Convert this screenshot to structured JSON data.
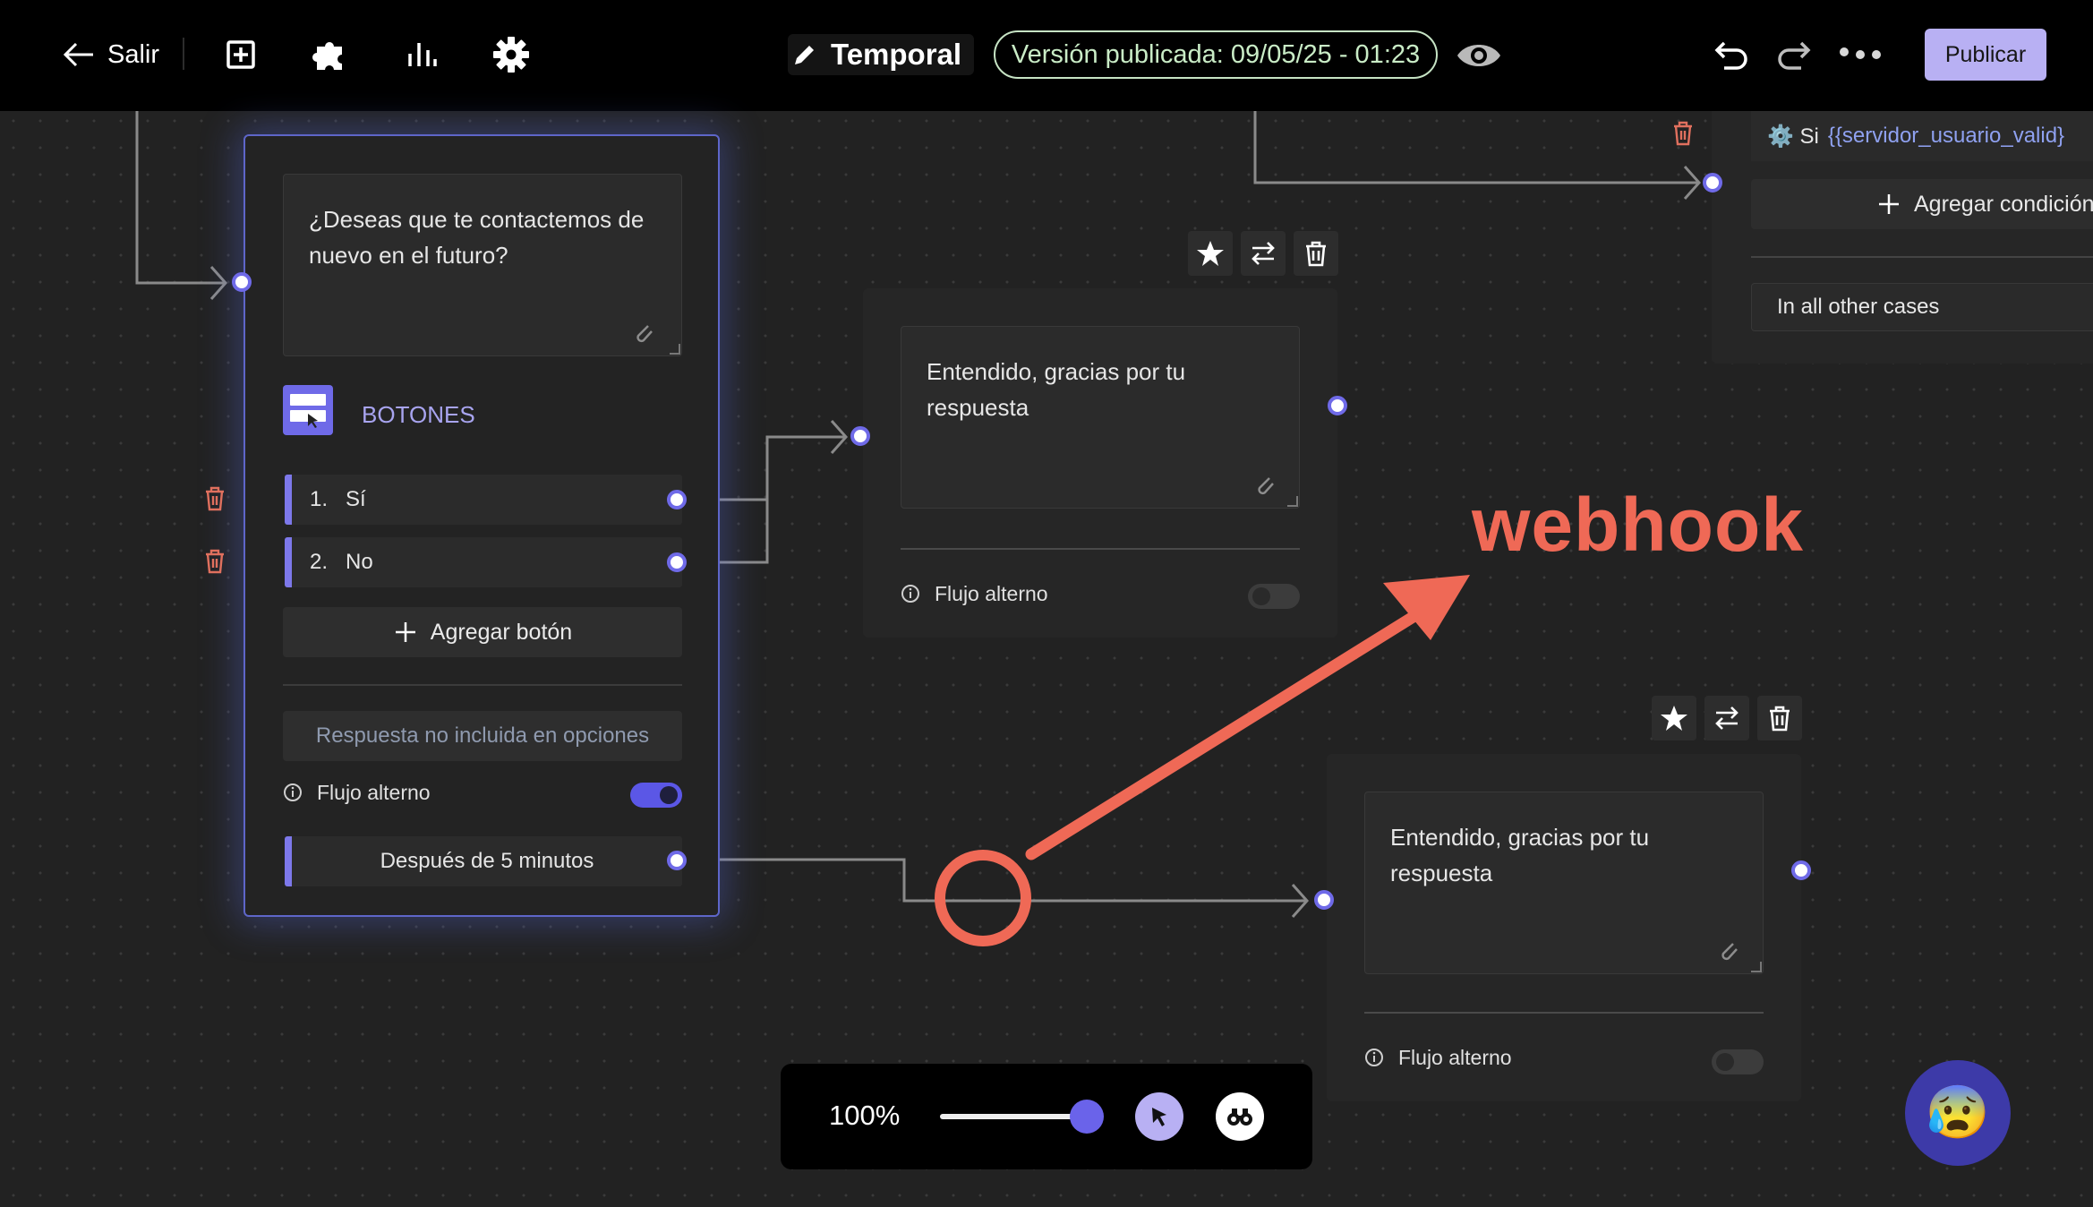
{
  "topbar": {
    "exit_label": "Salir",
    "flow_name": "Temporal",
    "version_badge": "Versión publicada: 09/05/25 - 01:23",
    "publish_label": "Publicar"
  },
  "question_node": {
    "message": "¿Deseas que te contactemos de nuevo en el futuro?",
    "section_title": "BOTONES",
    "buttons": [
      {
        "number": "1.",
        "label": "Sí"
      },
      {
        "number": "2.",
        "label": "No"
      }
    ],
    "add_button_label": "Agregar botón",
    "fallback_label": "Respuesta no incluida en opciones",
    "alt_flow_label": "Flujo alterno",
    "alt_flow_enabled": true,
    "timeout_label": "Después de 5 minutos"
  },
  "reply_node_top": {
    "message": "Entendido, gracias por tu respuesta",
    "alt_flow_label": "Flujo alterno",
    "alt_flow_enabled": false
  },
  "reply_node_bottom": {
    "message": "Entendido, gracias por tu respuesta",
    "alt_flow_label": "Flujo alterno",
    "alt_flow_enabled": false
  },
  "condition_node": {
    "condition_prefix": "⚙️ Si",
    "condition_variable": "{{servidor_usuario_valid}",
    "add_condition_label": "Agregar condición",
    "other_cases_label": "In all other cases"
  },
  "zoom": {
    "level_label": "100%",
    "level": 100
  },
  "annotation": {
    "label": "webhook"
  },
  "colors": {
    "accent": "#6f6ae8",
    "publish_bg": "#b8b0f3",
    "badge_green": "#c9ecc6",
    "annotation": "#ef6956",
    "danger": "#e0705e"
  },
  "support_emoji": "😰"
}
